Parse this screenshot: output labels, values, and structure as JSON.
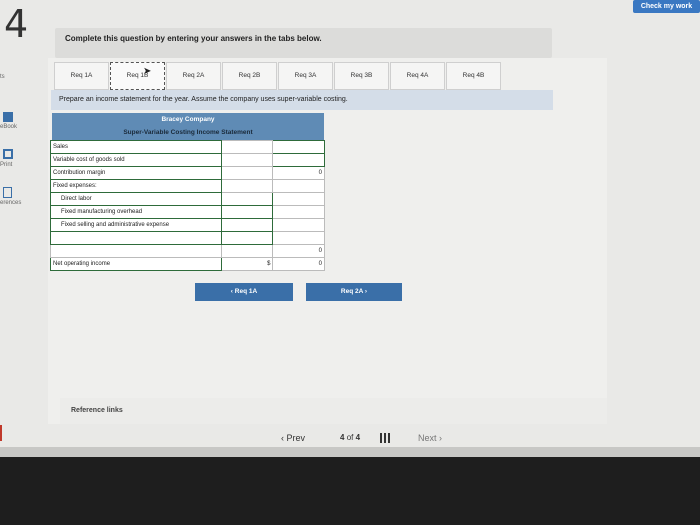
{
  "question_number": "4",
  "check_button": "Check my work",
  "instruction": "Complete this question by entering your answers in the tabs below.",
  "tabs": [
    "Req 1A",
    "Req 1B",
    "Req 2A",
    "Req 2B",
    "Req 3A",
    "Req 3B",
    "Req 4A",
    "Req 4B"
  ],
  "active_tab_index": 1,
  "prompt": "Prepare an income statement for the year. Assume the company uses super-variable costing.",
  "statement": {
    "company": "Bracey Company",
    "title": "Super-Variable Costing Income Statement",
    "rows": [
      {
        "label": "Sales",
        "col1": "",
        "col2": ""
      },
      {
        "label": "Variable cost of goods sold",
        "col1": "",
        "col2": ""
      },
      {
        "label": "Contribution margin",
        "col1": "",
        "col2": "0"
      },
      {
        "label": "Fixed expenses:",
        "col1": "",
        "col2": ""
      },
      {
        "label": "Direct labor",
        "col1": "",
        "col2": ""
      },
      {
        "label": "Fixed manufacturing overhead",
        "col1": "",
        "col2": ""
      },
      {
        "label": "Fixed selling and administrative expense",
        "col1": "",
        "col2": ""
      },
      {
        "label": "",
        "col1": "",
        "col2": ""
      },
      {
        "label": "",
        "col1": "",
        "col2": "0"
      },
      {
        "label": "Net operating income",
        "col1": "$",
        "col2": "0"
      }
    ]
  },
  "nav": {
    "prev_req": "Req 1A",
    "next_req": "Req 2A"
  },
  "reference_links": "Reference links",
  "pager": {
    "prev": "Prev",
    "current": "4",
    "of": "of",
    "total": "4",
    "next": "Next"
  },
  "left_rail": {
    "item0": "ts",
    "item1": "eBook",
    "item2": "Print",
    "item3": "erences"
  }
}
